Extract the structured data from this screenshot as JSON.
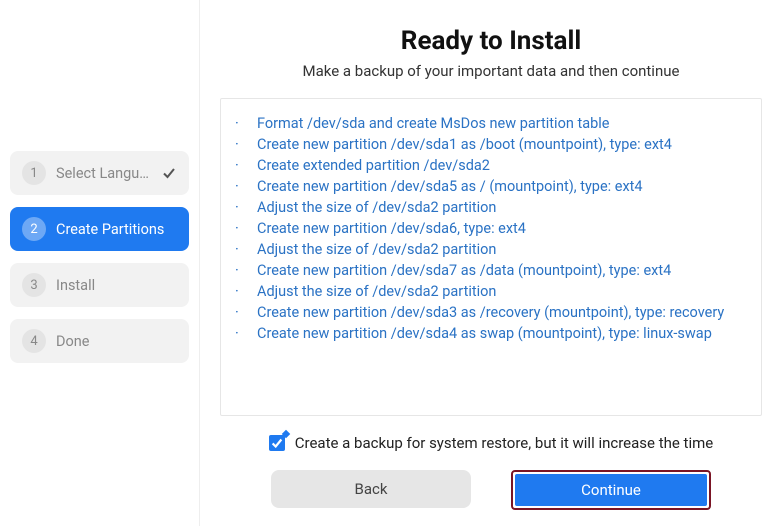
{
  "sidebar": {
    "steps": [
      {
        "num": "1",
        "label": "Select Langu…",
        "state": "completed"
      },
      {
        "num": "2",
        "label": "Create Partitions",
        "state": "active"
      },
      {
        "num": "3",
        "label": "Install",
        "state": "pending"
      },
      {
        "num": "4",
        "label": "Done",
        "state": "pending"
      }
    ]
  },
  "main": {
    "title": "Ready to Install",
    "subtitle": "Make a backup of your important data and then continue",
    "operations": [
      "Format /dev/sda and create MsDos new partition table",
      "Create new partition /dev/sda1 as /boot (mountpoint), type: ext4",
      "Create extended partition /dev/sda2",
      "Create new partition /dev/sda5 as / (mountpoint), type: ext4",
      "Adjust the size of /dev/sda2 partition",
      "Create new partition /dev/sda6, type: ext4",
      "Adjust the size of /dev/sda2 partition",
      "Create new partition /dev/sda7 as /data (mountpoint), type: ext4",
      "Adjust the size of /dev/sda2 partition",
      "Create new partition /dev/sda3 as /recovery (mountpoint), type: recovery",
      "Create new partition /dev/sda4 as swap (mountpoint), type: linux-swap"
    ],
    "backup_checked": true,
    "backup_label": "Create a backup for system restore, but it will increase the time",
    "back_label": "Back",
    "continue_label": "Continue"
  }
}
